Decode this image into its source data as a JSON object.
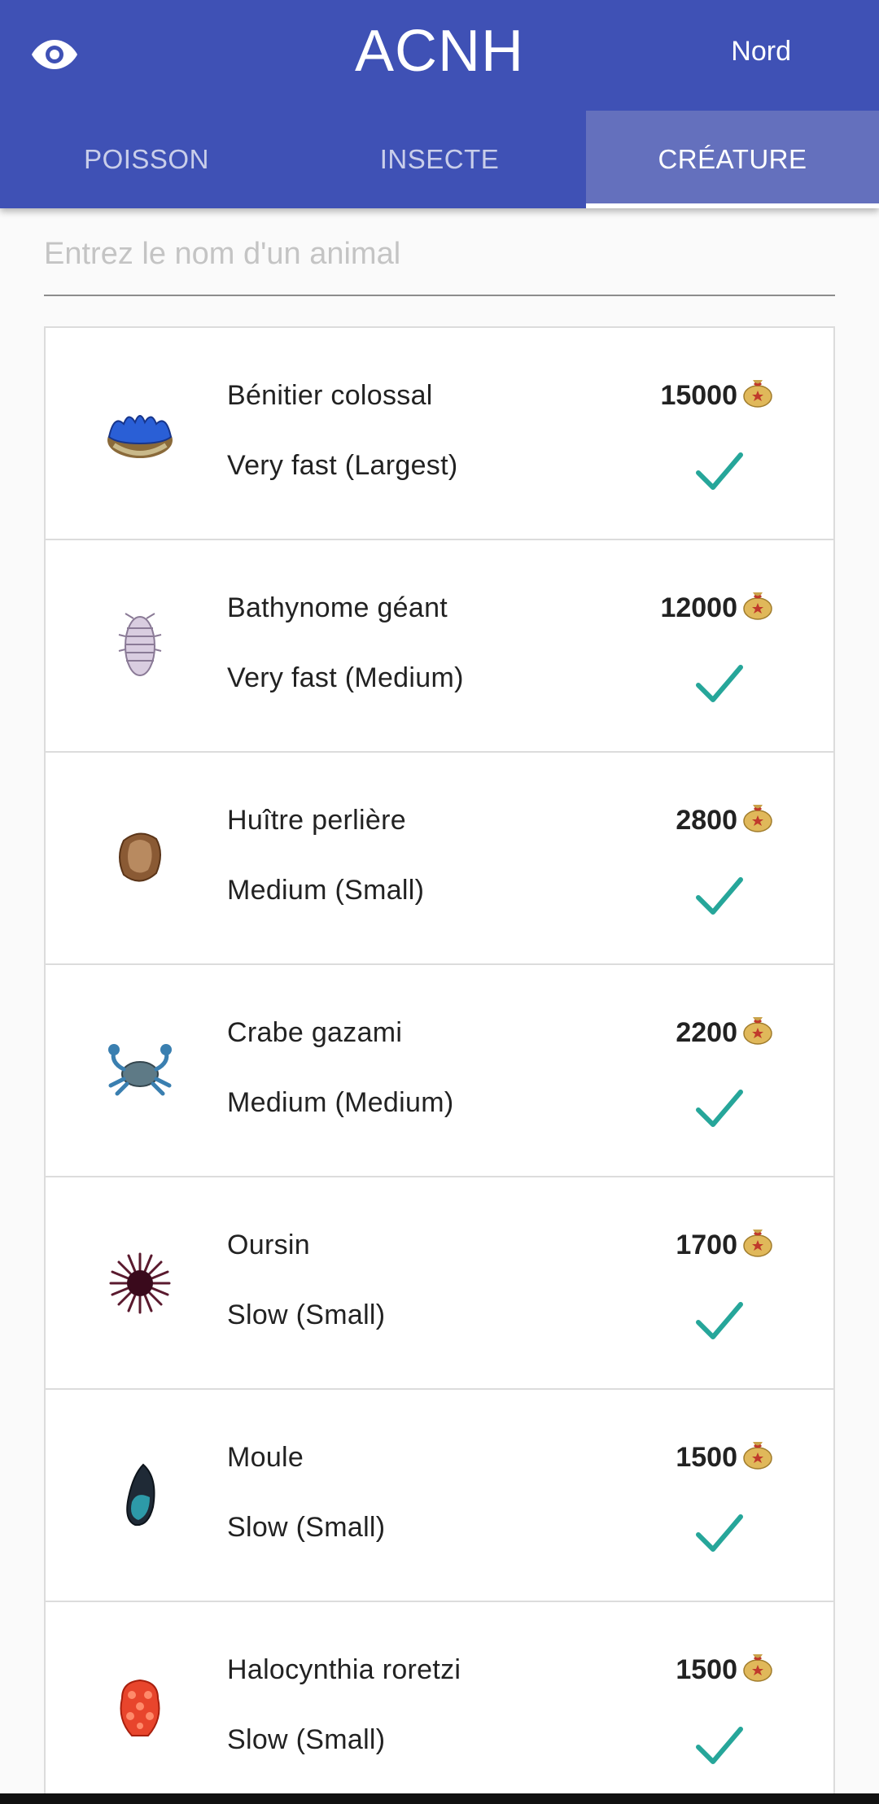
{
  "header": {
    "title": "ACNH",
    "hemisphere": "Nord",
    "eye_icon": "visibility-eye-icon"
  },
  "tabs": [
    {
      "label": "POISSON",
      "active": false
    },
    {
      "label": "INSECTE",
      "active": false
    },
    {
      "label": "CRÉATURE",
      "active": true
    }
  ],
  "search": {
    "placeholder": "Entrez le nom d'un animal",
    "value": ""
  },
  "colors": {
    "primary": "#3f51b5",
    "active_tab": "#6470bd",
    "check": "#26a69a"
  },
  "creatures": [
    {
      "name": "Bénitier colossal",
      "speed": "Very fast (Largest)",
      "price": "15000",
      "icon": "giant-clam-icon",
      "caught": true
    },
    {
      "name": "Bathynome géant",
      "speed": "Very fast (Medium)",
      "price": "12000",
      "icon": "giant-isopod-icon",
      "caught": true
    },
    {
      "name": "Huître perlière",
      "speed": "Medium (Small)",
      "price": "2800",
      "icon": "pearl-oyster-icon",
      "caught": true
    },
    {
      "name": "Crabe gazami",
      "speed": "Medium (Medium)",
      "price": "2200",
      "icon": "gazami-crab-icon",
      "caught": true
    },
    {
      "name": "Oursin",
      "speed": "Slow (Small)",
      "price": "1700",
      "icon": "sea-urchin-icon",
      "caught": true
    },
    {
      "name": "Moule",
      "speed": "Slow (Small)",
      "price": "1500",
      "icon": "mussel-icon",
      "caught": true
    },
    {
      "name": "Halocynthia roretzi",
      "speed": "Slow (Small)",
      "price": "1500",
      "icon": "sea-pineapple-icon",
      "caught": true
    }
  ]
}
